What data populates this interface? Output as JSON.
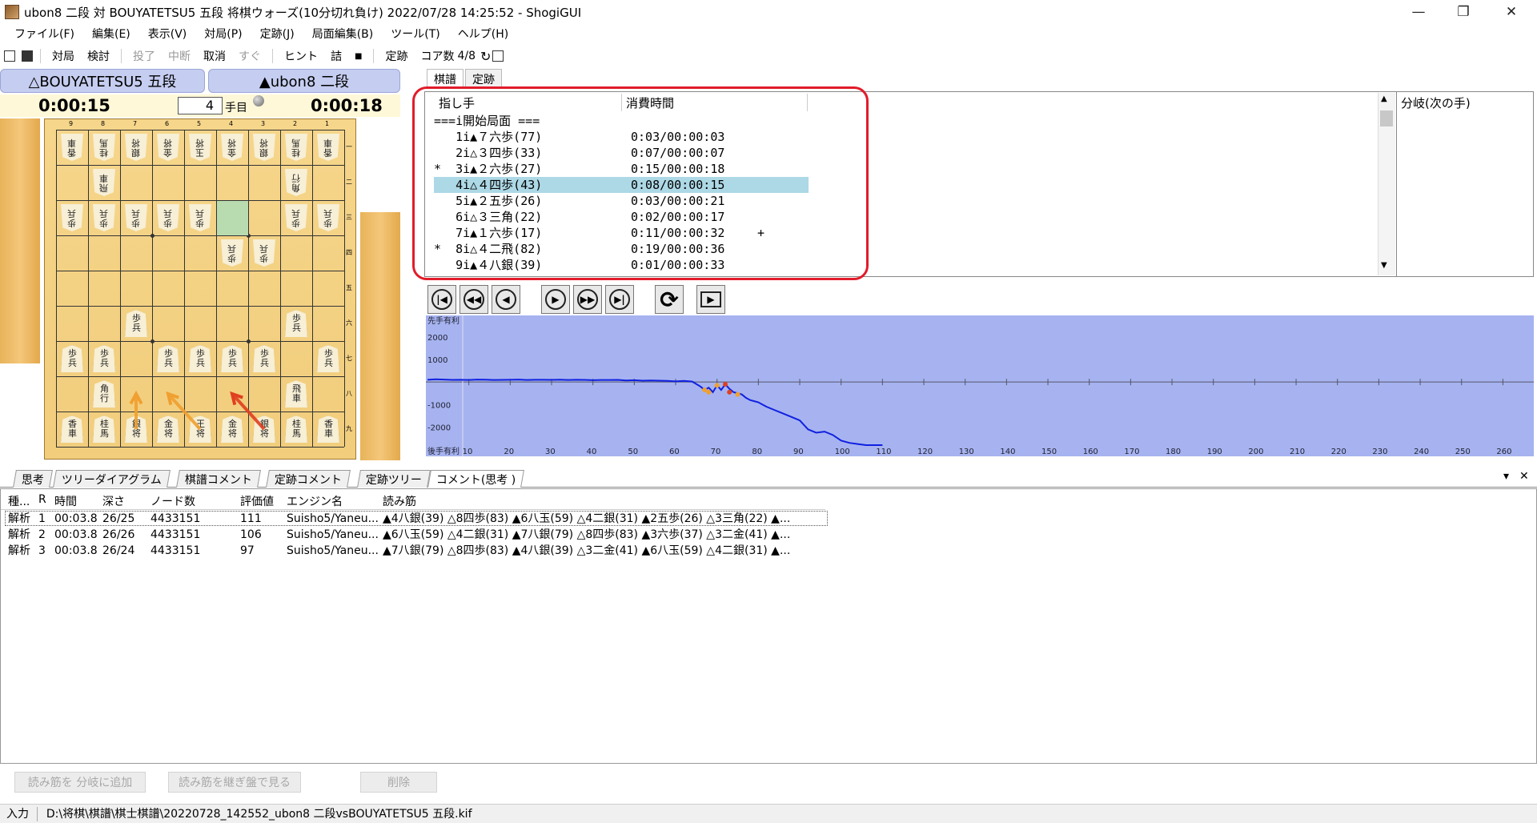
{
  "window": {
    "title": "ubon8 二段 対 BOUYATETSU5 五段 将棋ウォーズ(10分切れ負け) 2022/07/28 14:25:52 - ShogiGUI",
    "minimize": "—",
    "maximize": "❐",
    "close": "✕"
  },
  "menu": [
    "ファイル(F)",
    "編集(E)",
    "表示(V)",
    "対局(P)",
    "定跡(J)",
    "局面編集(B)",
    "ツール(T)",
    "ヘルプ(H)"
  ],
  "toolbar": {
    "play": "対局",
    "study": "検討",
    "resign": "投了",
    "interrupt": "中断",
    "undo": "取消",
    "now": "すぐ",
    "hint": "ヒント",
    "mate": "詰",
    "joseki": "定跡",
    "cores": "コア数",
    "cores_value": "4/8"
  },
  "players": {
    "gote": "△BOUYATETSU5 五段",
    "sente": "▲ubon8 二段",
    "gote_time": "0:00:15",
    "sente_time": "0:00:18",
    "move_number": "4",
    "move_label": "手目"
  },
  "board": {
    "file_labels": [
      "9",
      "8",
      "7",
      "6",
      "5",
      "4",
      "3",
      "2",
      "1"
    ],
    "rank_labels": [
      "一",
      "二",
      "三",
      "四",
      "五",
      "六",
      "七",
      "八",
      "九"
    ],
    "highlight_square": {
      "file": 4,
      "rank": 3
    },
    "pieces": [
      {
        "f": 9,
        "r": 1,
        "t": "香車",
        "g": true
      },
      {
        "f": 8,
        "r": 1,
        "t": "桂馬",
        "g": true
      },
      {
        "f": 7,
        "r": 1,
        "t": "銀将",
        "g": true
      },
      {
        "f": 6,
        "r": 1,
        "t": "金将",
        "g": true
      },
      {
        "f": 5,
        "r": 1,
        "t": "玉将",
        "g": true
      },
      {
        "f": 4,
        "r": 1,
        "t": "金将",
        "g": true
      },
      {
        "f": 3,
        "r": 1,
        "t": "銀将",
        "g": true
      },
      {
        "f": 2,
        "r": 1,
        "t": "桂馬",
        "g": true
      },
      {
        "f": 1,
        "r": 1,
        "t": "香車",
        "g": true
      },
      {
        "f": 8,
        "r": 2,
        "t": "飛車",
        "g": true
      },
      {
        "f": 2,
        "r": 2,
        "t": "角行",
        "g": true
      },
      {
        "f": 9,
        "r": 3,
        "t": "歩兵",
        "g": true
      },
      {
        "f": 8,
        "r": 3,
        "t": "歩兵",
        "g": true
      },
      {
        "f": 7,
        "r": 3,
        "t": "歩兵",
        "g": true
      },
      {
        "f": 6,
        "r": 3,
        "t": "歩兵",
        "g": true
      },
      {
        "f": 5,
        "r": 3,
        "t": "歩兵",
        "g": true
      },
      {
        "f": 2,
        "r": 3,
        "t": "歩兵",
        "g": true
      },
      {
        "f": 1,
        "r": 3,
        "t": "歩兵",
        "g": true
      },
      {
        "f": 4,
        "r": 4,
        "t": "歩兵",
        "g": true
      },
      {
        "f": 3,
        "r": 4,
        "t": "歩兵",
        "g": true
      },
      {
        "f": 7,
        "r": 6,
        "t": "歩兵",
        "g": false
      },
      {
        "f": 2,
        "r": 6,
        "t": "歩兵",
        "g": false
      },
      {
        "f": 9,
        "r": 7,
        "t": "歩兵",
        "g": false
      },
      {
        "f": 8,
        "r": 7,
        "t": "歩兵",
        "g": false
      },
      {
        "f": 6,
        "r": 7,
        "t": "歩兵",
        "g": false
      },
      {
        "f": 5,
        "r": 7,
        "t": "歩兵",
        "g": false
      },
      {
        "f": 4,
        "r": 7,
        "t": "歩兵",
        "g": false
      },
      {
        "f": 3,
        "r": 7,
        "t": "歩兵",
        "g": false
      },
      {
        "f": 1,
        "r": 7,
        "t": "歩兵",
        "g": false
      },
      {
        "f": 8,
        "r": 8,
        "t": "角行",
        "g": false
      },
      {
        "f": 2,
        "r": 8,
        "t": "飛車",
        "g": false
      },
      {
        "f": 9,
        "r": 9,
        "t": "香車",
        "g": false
      },
      {
        "f": 8,
        "r": 9,
        "t": "桂馬",
        "g": false
      },
      {
        "f": 7,
        "r": 9,
        "t": "銀将",
        "g": false
      },
      {
        "f": 6,
        "r": 9,
        "t": "金将",
        "g": false
      },
      {
        "f": 5,
        "r": 9,
        "t": "王将",
        "g": false
      },
      {
        "f": 4,
        "r": 9,
        "t": "金将",
        "g": false
      },
      {
        "f": 3,
        "r": 9,
        "t": "銀将",
        "g": false
      },
      {
        "f": 2,
        "r": 9,
        "t": "桂馬",
        "g": false
      },
      {
        "f": 1,
        "r": 9,
        "t": "香車",
        "g": false
      }
    ],
    "arrows": [
      {
        "from": {
          "f": 7,
          "r": 9
        },
        "to": {
          "f": 7,
          "r": 8
        },
        "color": "#f0a030"
      },
      {
        "from": {
          "f": 5,
          "r": 9
        },
        "to": {
          "f": 6,
          "r": 8
        },
        "color": "#f0a030"
      },
      {
        "from": {
          "f": 3,
          "r": 9
        },
        "to": {
          "f": 4,
          "r": 8
        },
        "color": "#e04020"
      }
    ]
  },
  "kifu_tabs": [
    "棋譜",
    "定跡"
  ],
  "kifu": {
    "col_move": "指し手",
    "col_time": "消費時間",
    "start": "===i開始局面 ===",
    "rows": [
      {
        "mark": " ",
        "num": "1",
        "move": "▲７六歩(77)",
        "time": "0:03/00:00:03",
        "extra": ""
      },
      {
        "mark": " ",
        "num": "2",
        "move": "△３四歩(33)",
        "time": "0:07/00:00:07",
        "extra": ""
      },
      {
        "mark": "*",
        "num": "3",
        "move": "▲２六歩(27)",
        "time": "0:15/00:00:18",
        "extra": ""
      },
      {
        "mark": " ",
        "num": "4",
        "move": "△４四歩(43)",
        "time": "0:08/00:00:15",
        "extra": ""
      },
      {
        "mark": " ",
        "num": "5",
        "move": "▲２五歩(26)",
        "time": "0:03/00:00:21",
        "extra": ""
      },
      {
        "mark": " ",
        "num": "6",
        "move": "△３三角(22)",
        "time": "0:02/00:00:17",
        "extra": ""
      },
      {
        "mark": " ",
        "num": "7",
        "move": "▲１六歩(17)",
        "time": "0:11/00:00:32",
        "extra": "+"
      },
      {
        "mark": "*",
        "num": "8",
        "move": "△４二飛(82)",
        "time": "0:19/00:00:36",
        "extra": ""
      },
      {
        "mark": " ",
        "num": "9",
        "move": "▲４八銀(39)",
        "time": "0:01/00:00:33",
        "extra": ""
      }
    ],
    "selected_index": 3
  },
  "branch_label": "分岐(次の手)",
  "chart_data": {
    "type": "line",
    "title": "",
    "top_label": "先手有利",
    "bottom_label": "後手有利",
    "xlabel": "",
    "ylabel": "",
    "ylim": [
      -2800,
      2600
    ],
    "xlim": [
      0,
      270
    ],
    "yticks": [
      2000,
      1000,
      -1000,
      -2000
    ],
    "ytick_labels": [
      "2000",
      "1000",
      "-1000",
      "-2000"
    ],
    "xticks": [
      10,
      20,
      30,
      40,
      50,
      60,
      70,
      80,
      90,
      100,
      110,
      120,
      130,
      140,
      150,
      160,
      170,
      180,
      190,
      200,
      210,
      220,
      230,
      240,
      250,
      260
    ],
    "line_color": "#1020e0",
    "background": "#a6b3f0",
    "series": [
      {
        "x": [
          0,
          2,
          4,
          6,
          8,
          10,
          12,
          14,
          16,
          18,
          20,
          22,
          24,
          26,
          28,
          30,
          32,
          34,
          36,
          38,
          40,
          42,
          44,
          46,
          48,
          50,
          52,
          54,
          56,
          58,
          60,
          62,
          64,
          66,
          67,
          68,
          69,
          70,
          71,
          72,
          73,
          74,
          75,
          76,
          77,
          78,
          79,
          80,
          81,
          82,
          84,
          86,
          88,
          90,
          92,
          94,
          96,
          98,
          100,
          102,
          104,
          106,
          108,
          110
        ],
        "y": [
          100,
          120,
          110,
          95,
          100,
          90,
          110,
          105,
          90,
          95,
          100,
          110,
          90,
          100,
          100,
          95,
          105,
          90,
          100,
          95,
          80,
          90,
          90,
          95,
          70,
          80,
          60,
          70,
          60,
          50,
          30,
          50,
          20,
          -200,
          -350,
          -250,
          -450,
          -150,
          -350,
          -100,
          -300,
          -450,
          -500,
          -550,
          -700,
          -800,
          -850,
          -900,
          -1000,
          -1100,
          -1250,
          -1400,
          -1550,
          -1700,
          -2100,
          -2250,
          -2200,
          -2350,
          -2600,
          -2700,
          -2750,
          -2800,
          -2800,
          -2800
        ]
      }
    ],
    "markers": [
      {
        "x": 67,
        "y": -350,
        "color": "#f0a030"
      },
      {
        "x": 68,
        "y": -450,
        "color": "#f0a030"
      },
      {
        "x": 70,
        "y": -150,
        "color": "#f0a030"
      },
      {
        "x": 72,
        "y": -100,
        "color": "#e04020"
      },
      {
        "x": 73,
        "y": -450,
        "color": "#e04020"
      },
      {
        "x": 75,
        "y": -550,
        "color": "#f0a030"
      }
    ]
  },
  "bottom_tabs": [
    "思考",
    "ツリーダイアグラム",
    "棋譜コメント",
    "定跡コメント",
    "定跡ツリー",
    "コメント(思考 )"
  ],
  "bottom_tabs_active": 5,
  "pane_pin": "▾",
  "pane_close": "✕",
  "pv": {
    "headers": [
      "種...",
      "R",
      "時間",
      "深さ",
      "ノード数",
      "評価値",
      "エンジン名",
      "読み筋"
    ],
    "rows": [
      {
        "kind": "解析",
        "r": "1",
        "time": "00:03.8",
        "depth": "26/25",
        "nodes": "4433151",
        "eval": "111",
        "engine": "Suisho5/Yaneu...",
        "pv": "▲4八銀(39) △8四歩(83) ▲6八玉(59) △4二銀(31) ▲2五歩(26) △3三角(22) ▲..."
      },
      {
        "kind": "解析",
        "r": "2",
        "time": "00:03.8",
        "depth": "26/26",
        "nodes": "4433151",
        "eval": "106",
        "engine": "Suisho5/Yaneu...",
        "pv": "▲6八玉(59) △4二銀(31) ▲7八銀(79) △8四歩(83) ▲3六歩(37) △3二金(41) ▲..."
      },
      {
        "kind": "解析",
        "r": "3",
        "time": "00:03.8",
        "depth": "26/24",
        "nodes": "4433151",
        "eval": "97",
        "engine": "Suisho5/Yaneu...",
        "pv": "▲7八銀(79) △8四歩(83) ▲4八銀(39) △3二金(41) ▲6八玉(59) △4二銀(31) ▲..."
      }
    ],
    "buttons": [
      "読み筋を 分岐に追加",
      "読み筋を継ぎ盤で見る",
      "削除"
    ]
  },
  "status": {
    "mode": "入力",
    "path": "D:\\将棋\\棋譜\\棋士棋譜\\20220728_142552_ubon8 二段vsBOUYATETSU5 五段.kif"
  }
}
